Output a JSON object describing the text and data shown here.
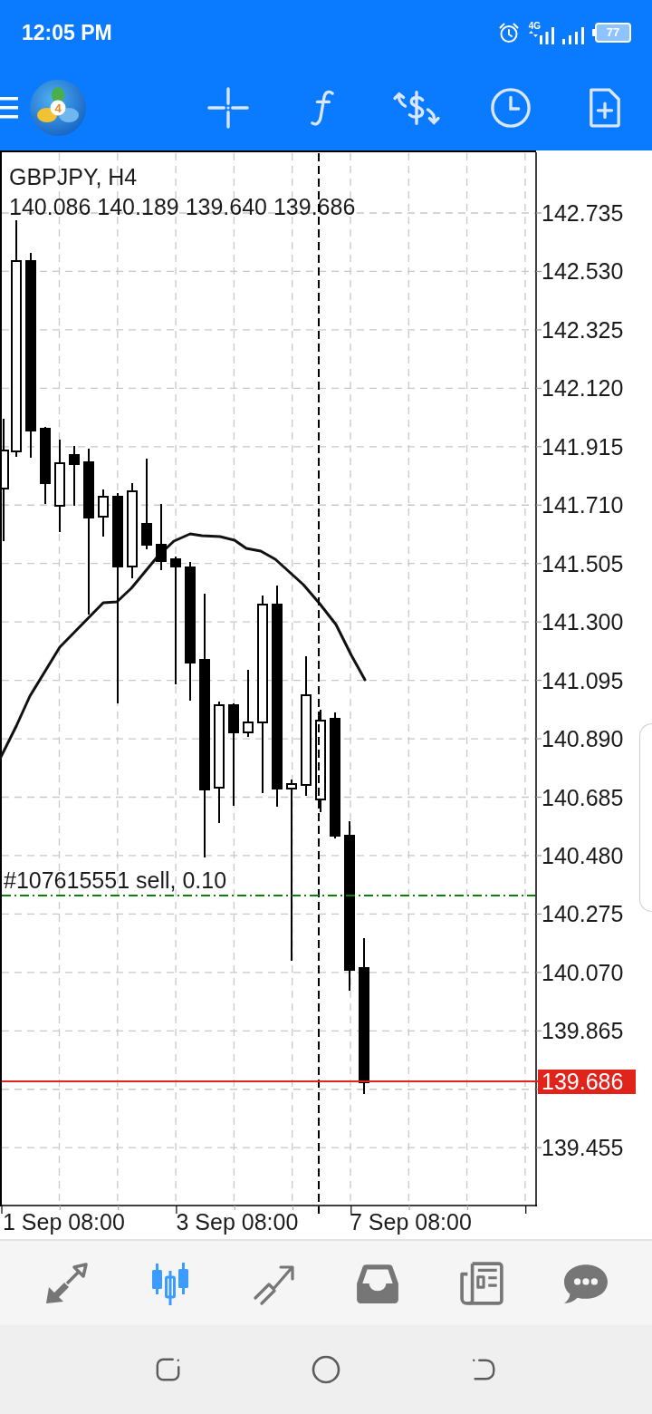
{
  "status_bar": {
    "time": "12:05 PM",
    "network": "4G",
    "battery": "77"
  },
  "app_logo": {
    "badge": "4"
  },
  "chart": {
    "symbol": "GBPJPY, H4",
    "ohlc": "140.086 140.189 139.640 139.686",
    "price_labels": [
      "142.735",
      "142.530",
      "142.325",
      "142.120",
      "141.915",
      "141.710",
      "141.505",
      "141.300",
      "141.095",
      "140.890",
      "140.685",
      "140.480",
      "140.275",
      "140.070",
      "139.865",
      "139.455"
    ],
    "order_label": "#107615551 sell, 0.10",
    "current_price": "139.686",
    "time_labels": [
      "1 Sep 08:00",
      "3 Sep 08:00",
      "7 Sep 08:00"
    ]
  },
  "bottom_nav": [
    {
      "selected": false
    },
    {
      "selected": true
    },
    {
      "selected": false
    },
    {
      "selected": false
    },
    {
      "selected": false
    },
    {
      "selected": false
    }
  ]
}
